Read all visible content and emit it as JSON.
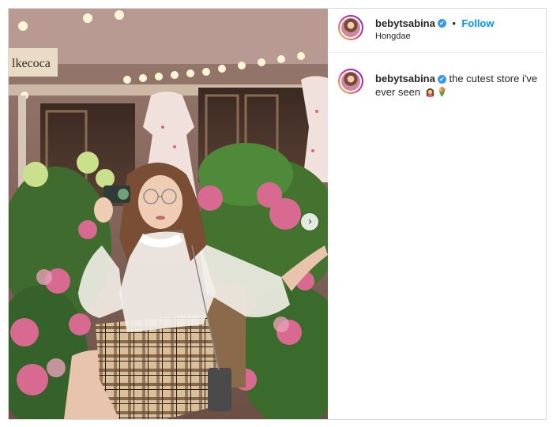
{
  "post": {
    "username": "bebytsabina",
    "follow_label": "Follow",
    "separator": "•",
    "location": "Hongdae",
    "caption": "the cutest store i've ever seen",
    "verified_mark": "✔",
    "store_sign": "lkecoca",
    "caption_emojis": [
      "woman-gesturing-ok-emoji",
      "bouquet-emoji"
    ],
    "carousel_next_symbol": "›"
  },
  "colors": {
    "follow": "#0095f6",
    "verified": "#3897f0",
    "border": "#dbdbdb"
  }
}
